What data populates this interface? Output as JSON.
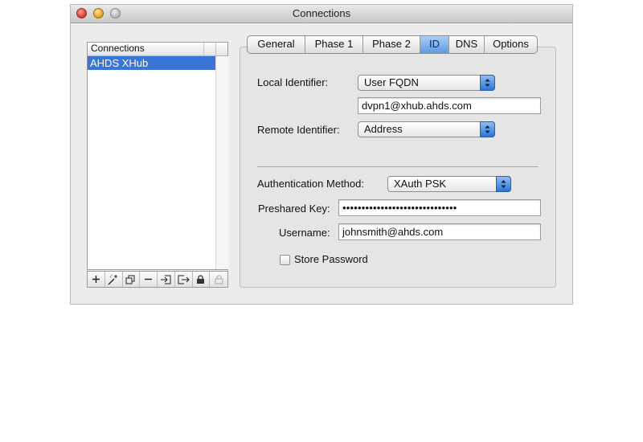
{
  "window": {
    "title": "Connections"
  },
  "connections": {
    "header": "Connections",
    "items": [
      "AHDS XHub"
    ]
  },
  "toolbar": {
    "icons": [
      "plus-icon",
      "wand-icon",
      "duplicate-icon",
      "minus-icon",
      "import-icon",
      "export-icon",
      "lock-icon",
      "unlock-icon"
    ]
  },
  "tabs": [
    {
      "label": "General"
    },
    {
      "label": "Phase 1"
    },
    {
      "label": "Phase 2"
    },
    {
      "label": "ID"
    },
    {
      "label": "DNS"
    },
    {
      "label": "Options"
    }
  ],
  "active_tab": "ID",
  "form": {
    "local_identifier_label": "Local Identifier:",
    "local_identifier_value": "User FQDN",
    "local_identifier_text": "dvpn1@xhub.ahds.com",
    "remote_identifier_label": "Remote Identifier:",
    "remote_identifier_value": "Address",
    "auth_method_label": "Authentication Method:",
    "auth_method_value": "XAuth PSK",
    "preshared_key_label": "Preshared Key:",
    "preshared_key_value": "••••••••••••••••••••••••••••••",
    "username_label": "Username:",
    "username_value": "johnsmith@ahds.com",
    "store_password_label": "Store Password"
  },
  "colors": {
    "selection": "#3875d7",
    "accent": "#5c9ce6"
  }
}
